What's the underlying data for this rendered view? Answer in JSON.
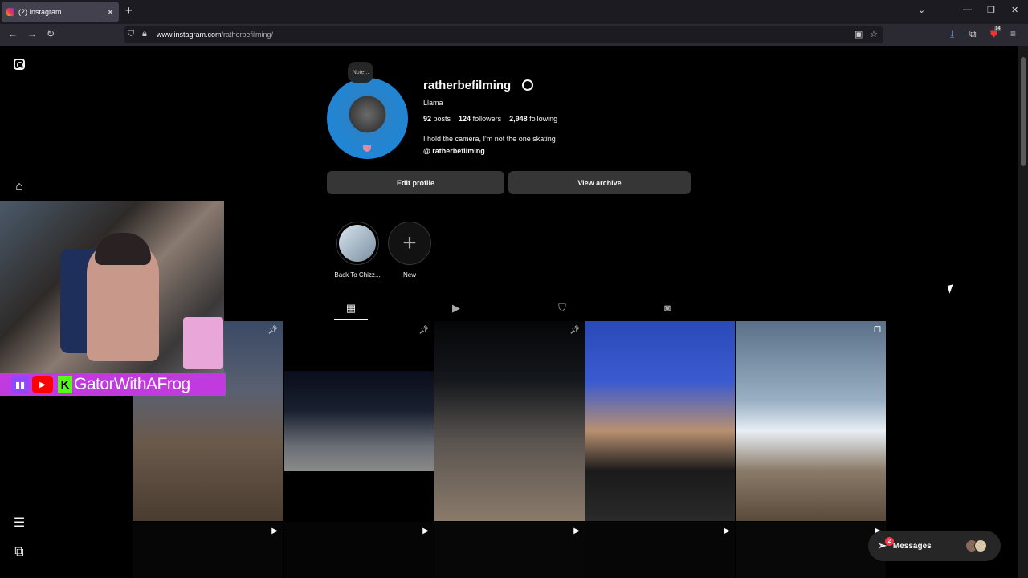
{
  "browser": {
    "tab_title": "(2) Instagram",
    "tab_close": "✕",
    "new_tab": "+",
    "url_prefix": "www.instagram.com",
    "url_path": "/ratherbefilming/",
    "extensions_badge": "14"
  },
  "profile": {
    "note": "Note...",
    "username": "ratherbefilming",
    "full_name": "Llama",
    "posts_count": "92",
    "posts_label": "posts",
    "followers_count": "124",
    "followers_label": "followers",
    "following_count": "2,948",
    "following_label": "following",
    "bio": "I hold the camera, I'm not the one skating",
    "threads_handle": "ratherbefilming",
    "edit_label": "Edit profile",
    "archive_label": "View archive"
  },
  "highlights": [
    {
      "label": "Back To Chizz..."
    },
    {
      "label": "New"
    }
  ],
  "overlay": {
    "streamer_name": "GatorWithAFrog",
    "kick_letter": "K"
  },
  "messages": {
    "label": "Messages",
    "badge": "2"
  },
  "colors": {
    "page_bg": "#000000",
    "button_bg": "#363636",
    "accent_badge": "#ff3040",
    "overlay_magenta": "#c03ae0"
  }
}
